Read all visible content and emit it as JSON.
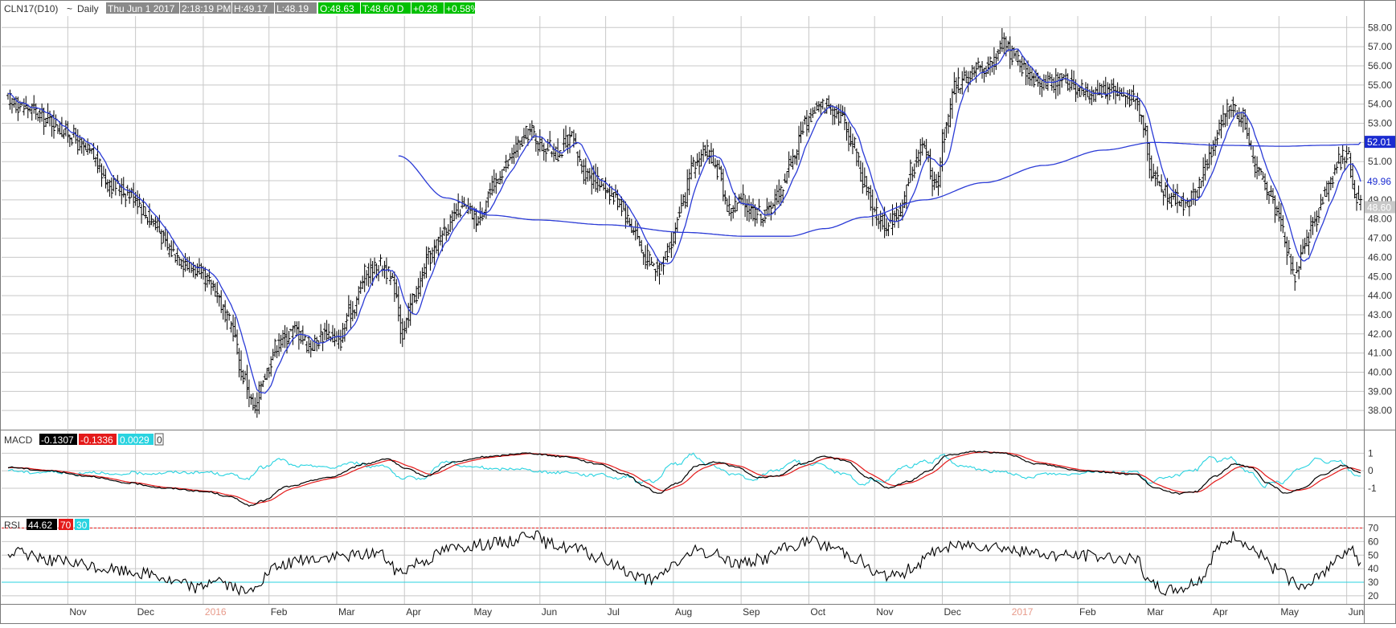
{
  "header": {
    "symbol": "CLN17(D10)",
    "separator": "~",
    "period": "Daily",
    "datetime": "Thu Jun 1 2017",
    "time": "2:18:19 PM",
    "high": "H:49.17",
    "low": "L:48.19",
    "open": "O:48.63",
    "last": "T:48.60 D",
    "change": "+0.28",
    "change_pct": "+0.58%"
  },
  "colors": {
    "price_bars": "#000000",
    "ma": "#2b3bd6",
    "macd_line": "#000000",
    "signal_line": "#e41a1a",
    "histogram_line": "#29d3e0",
    "rsi_line": "#000000",
    "rsi_upper": "#e41a1a",
    "rsi_lower": "#29d3e0",
    "up_badge": "#00c000",
    "grid": "#c8c8c8"
  },
  "chart_data": [
    {
      "type": "ohlc",
      "panel": "price",
      "series": [
        {
          "kind": "price_bars",
          "role": "daily OHLC bars"
        },
        {
          "kind": "moving_average",
          "role": "short MA",
          "last_value": 49.96
        },
        {
          "kind": "moving_average",
          "role": "long MA",
          "last_value": 52.01
        }
      ],
      "ylim": [
        37.0,
        58.6
      ],
      "yticks": [
        "38.00",
        "39.00",
        "40.00",
        "41.00",
        "42.00",
        "43.00",
        "44.00",
        "45.00",
        "46.00",
        "47.00",
        "48.00",
        "49.00",
        "50.00",
        "51.00",
        "52.00",
        "53.00",
        "54.00",
        "55.00",
        "56.00",
        "57.00",
        "58.00"
      ],
      "price_labels": {
        "last_price": "48.60",
        "short_ma": "49.96",
        "long_ma": "52.01"
      },
      "months": [
        "Nov",
        "Dec",
        "2016",
        "Feb",
        "Mar",
        "Apr",
        "May",
        "Jun",
        "Jul",
        "Aug",
        "Sep",
        "Oct",
        "Nov",
        "Dec",
        "2017",
        "Feb",
        "Mar",
        "Apr",
        "May",
        "Jun"
      ],
      "price_anchors": [
        [
          0,
          54.2
        ],
        [
          10,
          53.8
        ],
        [
          20,
          53.2
        ],
        [
          30,
          52.5
        ],
        [
          40,
          51.5
        ],
        [
          52,
          49.8
        ],
        [
          62,
          49.3
        ],
        [
          72,
          48.0
        ],
        [
          82,
          46.3
        ],
        [
          92,
          45.5
        ],
        [
          102,
          44.6
        ],
        [
          112,
          42.5
        ],
        [
          118,
          39.8
        ],
        [
          124,
          38.0
        ],
        [
          128,
          39.8
        ],
        [
          136,
          41.6
        ],
        [
          144,
          42.2
        ],
        [
          152,
          41.4
        ],
        [
          160,
          42.1
        ],
        [
          166,
          41.6
        ],
        [
          172,
          43.2
        ],
        [
          180,
          45.2
        ],
        [
          188,
          45.6
        ],
        [
          194,
          44.5
        ],
        [
          198,
          42.0
        ],
        [
          204,
          44.0
        ],
        [
          212,
          46.1
        ],
        [
          220,
          47.6
        ],
        [
          228,
          48.6
        ],
        [
          236,
          48.0
        ],
        [
          242,
          49.5
        ],
        [
          250,
          50.8
        ],
        [
          256,
          51.8
        ],
        [
          262,
          52.6
        ],
        [
          268,
          51.8
        ],
        [
          276,
          51.5
        ],
        [
          282,
          52.2
        ],
        [
          290,
          50.4
        ],
        [
          298,
          49.8
        ],
        [
          306,
          49.0
        ],
        [
          314,
          47.5
        ],
        [
          320,
          46.0
        ],
        [
          326,
          45.4
        ],
        [
          332,
          46.5
        ],
        [
          338,
          48.6
        ],
        [
          344,
          50.7
        ],
        [
          350,
          51.6
        ],
        [
          356,
          50.6
        ],
        [
          362,
          48.5
        ],
        [
          368,
          48.9
        ],
        [
          374,
          48.4
        ],
        [
          380,
          48.2
        ],
        [
          386,
          49.2
        ],
        [
          394,
          51.2
        ],
        [
          400,
          53.0
        ],
        [
          406,
          53.8
        ],
        [
          412,
          54.0
        ],
        [
          418,
          53.4
        ],
        [
          424,
          52.0
        ],
        [
          430,
          49.8
        ],
        [
          436,
          48.2
        ],
        [
          442,
          47.6
        ],
        [
          448,
          48.5
        ],
        [
          454,
          50.7
        ],
        [
          460,
          51.8
        ],
        [
          466,
          49.5
        ],
        [
          470,
          52.5
        ],
        [
          476,
          55.0
        ],
        [
          482,
          55.5
        ],
        [
          488,
          55.8
        ],
        [
          494,
          56.2
        ],
        [
          500,
          57.2
        ],
        [
          506,
          56.4
        ],
        [
          512,
          55.6
        ],
        [
          518,
          55.3
        ],
        [
          524,
          55.0
        ],
        [
          530,
          55.3
        ],
        [
          536,
          54.9
        ],
        [
          542,
          54.5
        ],
        [
          548,
          54.7
        ],
        [
          554,
          54.8
        ],
        [
          560,
          54.4
        ],
        [
          566,
          54.2
        ],
        [
          570,
          53.0
        ],
        [
          574,
          50.5
        ],
        [
          580,
          49.5
        ],
        [
          586,
          49.0
        ],
        [
          592,
          48.8
        ],
        [
          596,
          49.4
        ],
        [
          600,
          50.5
        ],
        [
          604,
          51.5
        ],
        [
          610,
          53.2
        ],
        [
          614,
          53.9
        ],
        [
          620,
          53.3
        ],
        [
          626,
          50.8
        ],
        [
          632,
          49.6
        ],
        [
          638,
          48.2
        ],
        [
          642,
          46.4
        ],
        [
          646,
          45.0
        ],
        [
          650,
          46.3
        ],
        [
          656,
          48.0
        ],
        [
          662,
          49.6
        ],
        [
          668,
          51.0
        ],
        [
          672,
          51.4
        ],
        [
          676,
          49.5
        ],
        [
          679,
          48.6
        ]
      ],
      "long_ma_anchors": [
        [
          196,
          51.3
        ],
        [
          220,
          49.1
        ],
        [
          242,
          48.2
        ],
        [
          266,
          47.95
        ],
        [
          300,
          47.7
        ],
        [
          340,
          47.3
        ],
        [
          370,
          47.1
        ],
        [
          392,
          47.1
        ],
        [
          410,
          47.5
        ],
        [
          430,
          48.1
        ],
        [
          460,
          49.0
        ],
        [
          490,
          49.9
        ],
        [
          520,
          50.8
        ],
        [
          550,
          51.6
        ],
        [
          575,
          52.0
        ],
        [
          610,
          51.85
        ],
        [
          640,
          51.8
        ],
        [
          660,
          51.85
        ],
        [
          679,
          51.9
        ]
      ],
      "macd_ylim": [
        -2.6,
        2.3
      ],
      "macd_ticks": [
        "1",
        "0",
        "-1"
      ],
      "macd_labels": {
        "title": "MACD",
        "macd": "-0.1307",
        "signal": "-0.1336",
        "hist": "0.0029",
        "tail": "0"
      },
      "macd_anchors": [
        [
          0,
          0.2
        ],
        [
          20,
          0.0
        ],
        [
          40,
          -0.3
        ],
        [
          60,
          -0.7
        ],
        [
          80,
          -1.0
        ],
        [
          100,
          -1.2
        ],
        [
          112,
          -1.5
        ],
        [
          122,
          -2.0
        ],
        [
          128,
          -1.7
        ],
        [
          140,
          -0.9
        ],
        [
          160,
          -0.4
        ],
        [
          180,
          0.4
        ],
        [
          190,
          0.7
        ],
        [
          200,
          0.1
        ],
        [
          210,
          -0.3
        ],
        [
          224,
          0.5
        ],
        [
          240,
          0.8
        ],
        [
          260,
          1.0
        ],
        [
          280,
          0.8
        ],
        [
          296,
          0.4
        ],
        [
          310,
          -0.2
        ],
        [
          320,
          -0.9
        ],
        [
          326,
          -1.3
        ],
        [
          336,
          -0.7
        ],
        [
          346,
          0.3
        ],
        [
          356,
          0.5
        ],
        [
          366,
          0.2
        ],
        [
          376,
          -0.4
        ],
        [
          386,
          -0.3
        ],
        [
          398,
          0.4
        ],
        [
          410,
          0.8
        ],
        [
          420,
          0.6
        ],
        [
          432,
          -0.4
        ],
        [
          442,
          -1.0
        ],
        [
          452,
          -0.6
        ],
        [
          462,
          0.0
        ],
        [
          472,
          0.9
        ],
        [
          486,
          1.1
        ],
        [
          500,
          1.0
        ],
        [
          516,
          0.4
        ],
        [
          540,
          0.0
        ],
        [
          566,
          -0.2
        ],
        [
          576,
          -1.0
        ],
        [
          588,
          -1.3
        ],
        [
          596,
          -1.2
        ],
        [
          606,
          -0.3
        ],
        [
          616,
          0.4
        ],
        [
          624,
          0.2
        ],
        [
          632,
          -0.7
        ],
        [
          642,
          -1.3
        ],
        [
          650,
          -1.0
        ],
        [
          660,
          -0.2
        ],
        [
          670,
          0.3
        ],
        [
          679,
          -0.1
        ]
      ],
      "rsi_ylim": [
        14,
        78
      ],
      "rsi_ticks": [
        "70",
        "60",
        "50",
        "40",
        "30",
        "20"
      ],
      "rsi_levels": {
        "upper": 70,
        "lower": 30
      },
      "rsi_labels": {
        "title": "RSI",
        "value": "44.62",
        "upper": "70",
        "lower": "30"
      },
      "rsi_anchors": [
        [
          0,
          52
        ],
        [
          12,
          50
        ],
        [
          24,
          46
        ],
        [
          36,
          43
        ],
        [
          48,
          40
        ],
        [
          60,
          38
        ],
        [
          72,
          36
        ],
        [
          84,
          30
        ],
        [
          96,
          26
        ],
        [
          104,
          33
        ],
        [
          112,
          27
        ],
        [
          120,
          21
        ],
        [
          126,
          30
        ],
        [
          134,
          40
        ],
        [
          146,
          46
        ],
        [
          160,
          48
        ],
        [
          174,
          50
        ],
        [
          186,
          52
        ],
        [
          196,
          38
        ],
        [
          208,
          46
        ],
        [
          222,
          55
        ],
        [
          236,
          58
        ],
        [
          252,
          60
        ],
        [
          262,
          67
        ],
        [
          272,
          58
        ],
        [
          284,
          55
        ],
        [
          296,
          48
        ],
        [
          306,
          42
        ],
        [
          316,
          34
        ],
        [
          324,
          31
        ],
        [
          336,
          45
        ],
        [
          346,
          53
        ],
        [
          356,
          50
        ],
        [
          366,
          44
        ],
        [
          378,
          47
        ],
        [
          390,
          55
        ],
        [
          402,
          60
        ],
        [
          414,
          56
        ],
        [
          426,
          48
        ],
        [
          436,
          36
        ],
        [
          446,
          34
        ],
        [
          456,
          43
        ],
        [
          468,
          55
        ],
        [
          482,
          58
        ],
        [
          496,
          57
        ],
        [
          510,
          52
        ],
        [
          530,
          50
        ],
        [
          550,
          49
        ],
        [
          566,
          47
        ],
        [
          574,
          28
        ],
        [
          582,
          24
        ],
        [
          590,
          26
        ],
        [
          598,
          32
        ],
        [
          608,
          55
        ],
        [
          616,
          64
        ],
        [
          626,
          52
        ],
        [
          636,
          40
        ],
        [
          646,
          30
        ],
        [
          652,
          25
        ],
        [
          660,
          38
        ],
        [
          670,
          52
        ],
        [
          674,
          56
        ],
        [
          679,
          42
        ]
      ]
    }
  ]
}
